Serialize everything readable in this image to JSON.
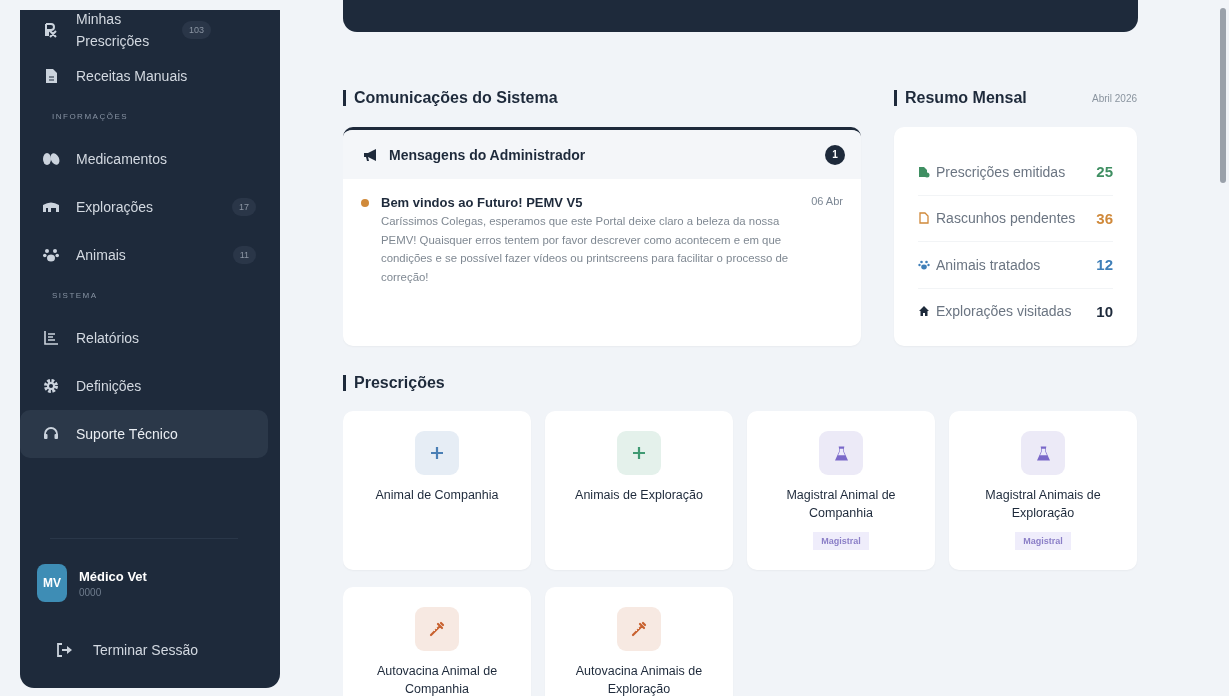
{
  "sidebar": {
    "sections": [
      {
        "items": [
          {
            "label": "Minhas Prescrições",
            "badge": "103",
            "selected": false
          },
          {
            "label": "Receitas Manuais",
            "selected": false
          }
        ]
      },
      {
        "heading": "INFORMAÇÕES",
        "items": [
          {
            "label": "Medicamentos",
            "selected": false
          },
          {
            "label": "Explorações",
            "badge": "17",
            "selected": false
          },
          {
            "label": "Animais",
            "badge": "11",
            "selected": false
          }
        ]
      },
      {
        "heading": "SISTEMA",
        "items": [
          {
            "label": "Relatórios",
            "selected": false
          },
          {
            "label": "Definições",
            "selected": false
          },
          {
            "label": "Suporte Técnico",
            "selected": true
          }
        ]
      }
    ],
    "user": {
      "initials": "MV",
      "name": "Médico Vet",
      "id": "0000"
    },
    "logout": "Terminar Sessão"
  },
  "communications": {
    "title": "Comunicações do Sistema",
    "panel_title": "Mensagens do Administrador",
    "count": "1",
    "messages": [
      {
        "title": "Bem vindos ao Futuro! PEMV V5",
        "date": "06 Abr",
        "color": "#d08a3a",
        "body": "Caríssimos Colegas, esperamos que este Portal deixe claro a beleza da nossa PEMV! Quaisquer erros tentem por favor descrever como acontecem e em que condições e se possível fazer vídeos ou printscreens para facilitar o processo de correção!"
      }
    ]
  },
  "summary": {
    "title": "Resumo Mensal",
    "period": "Abril 2026",
    "rows": [
      {
        "label": "Prescrições emitidas",
        "value": "25",
        "color": "#3f8f62"
      },
      {
        "label": "Rascunhos pendentes",
        "value": "36",
        "color": "#d0893a"
      },
      {
        "label": "Animais tratados",
        "value": "12",
        "color": "#3f7fb8"
      },
      {
        "label": "Explorações visitadas",
        "value": "10",
        "color": "#1e2a3b"
      }
    ]
  },
  "prescriptions": {
    "title": "Prescrições",
    "cards": [
      {
        "kind": "plus",
        "label": "Animal de Companhia",
        "color": "#4a7fb5"
      },
      {
        "kind": "plus",
        "label": "Animais de Exploração",
        "color": "#3f9a72"
      },
      {
        "kind": "flask",
        "label": "Magistral Animal de Companhia",
        "tag": "Magistral",
        "color": "#7a68c9"
      },
      {
        "kind": "flask",
        "label": "Magistral Animais de Exploração",
        "tag": "Magistral",
        "color": "#7a68c9"
      },
      {
        "kind": "syringe",
        "label": "Autovacina Animal de Companhia",
        "color": "#c8612f"
      },
      {
        "kind": "syringe",
        "label": "Autovacina Animais de Exploração",
        "color": "#c8612f"
      }
    ]
  }
}
